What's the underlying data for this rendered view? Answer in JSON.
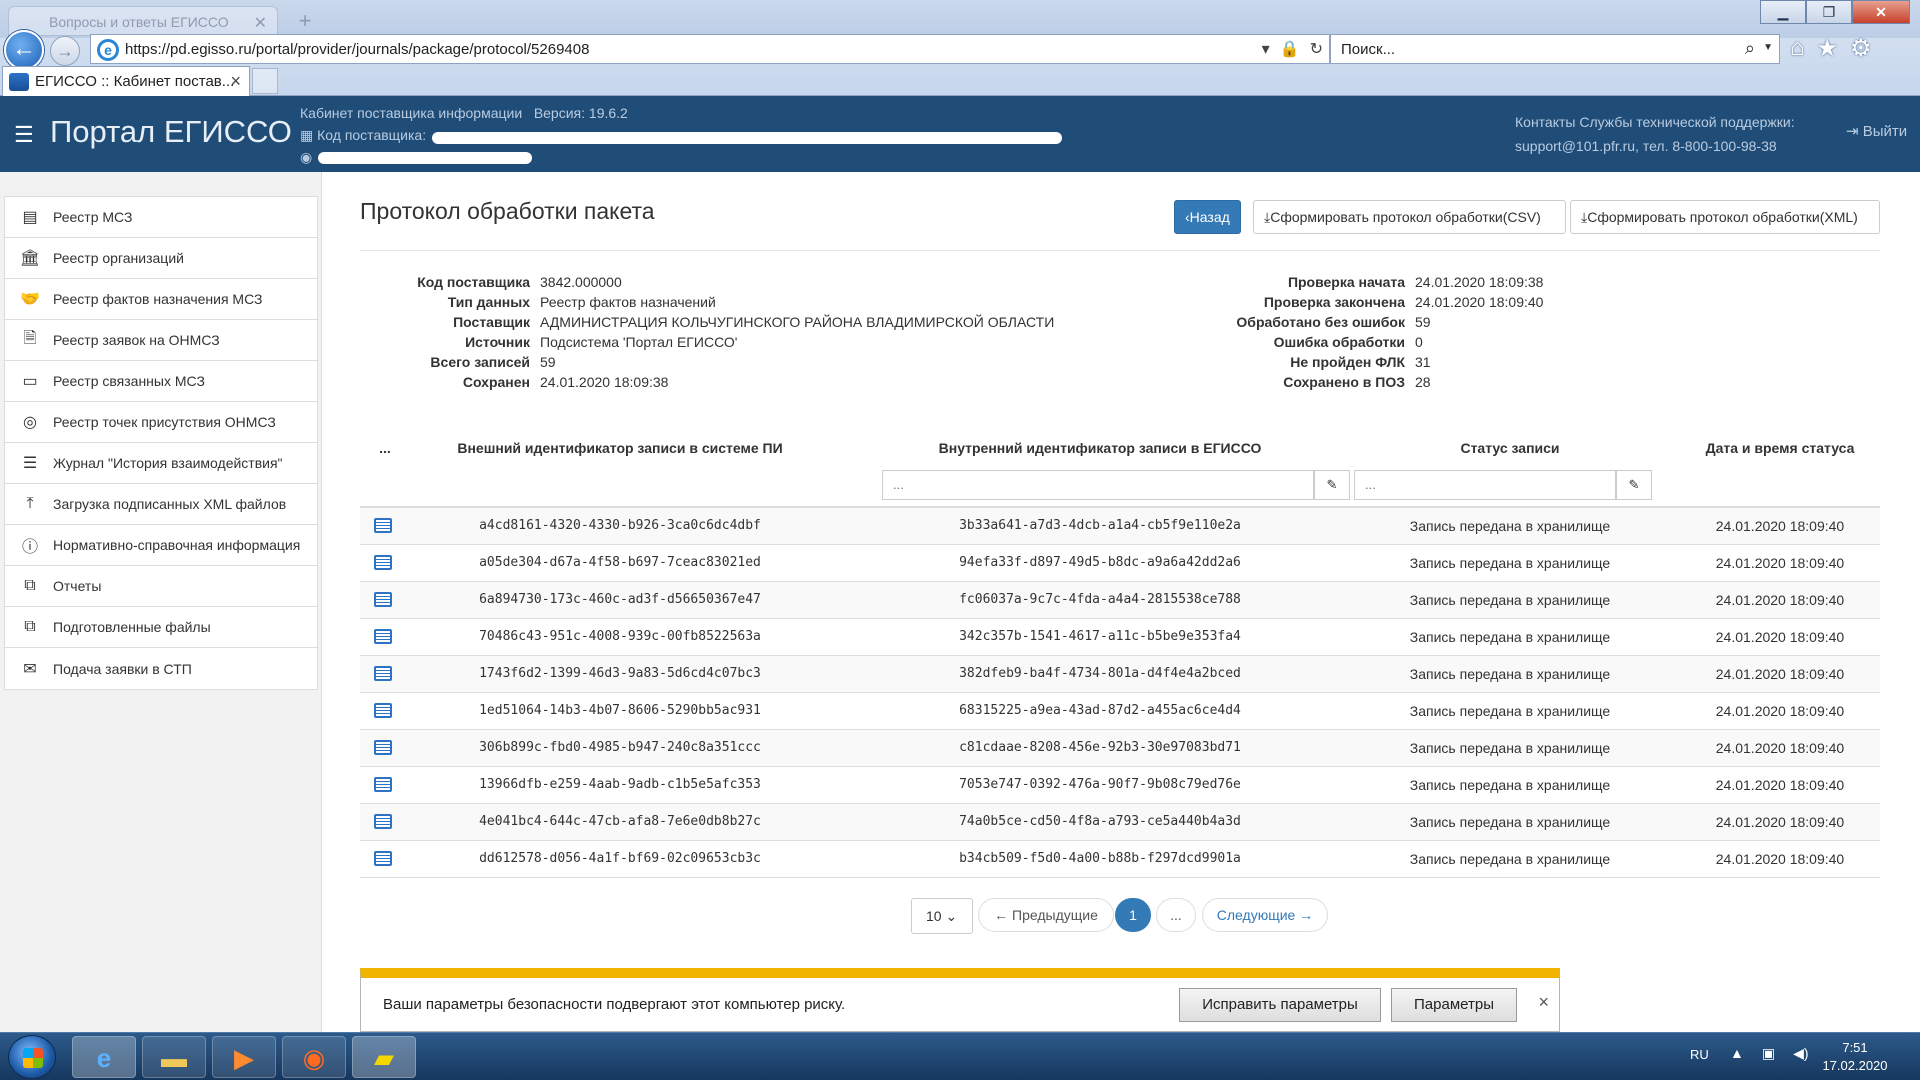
{
  "browser": {
    "ghost_tab_title": "Вопросы и ответы ЕГИССО",
    "url": "https://pd.egisso.ru/portal/provider/journals/package/protocol/5269408",
    "search_placeholder": "Поиск...",
    "tab_title": "ЕГИССО :: Кабинет постав...",
    "icons": [
      "back-arrow-icon",
      "forward-arrow-icon",
      "lock-icon",
      "refresh-icon",
      "search-icon",
      "home-icon",
      "star-icon",
      "gear-icon"
    ]
  },
  "header": {
    "title": "Портал ЕГИССО",
    "cabinet": "Кабинет поставщика информации",
    "version": "Версия: 19.6.2",
    "provider_code_label": "Код поставщика:",
    "support_title": "Контакты Службы технической поддержки:",
    "support_contacts": "support@101.pfr.ru, тел. 8-800-100-98-38",
    "logout": "Выйти"
  },
  "sidebar": {
    "items": [
      {
        "label": "Реестр МСЗ",
        "icon": "book-icon"
      },
      {
        "label": "Реестр организаций",
        "icon": "institution-icon"
      },
      {
        "label": "Реестр фактов назначения МСЗ",
        "icon": "handshake-icon"
      },
      {
        "label": "Реестр заявок на ОНМСЗ",
        "icon": "document-icon"
      },
      {
        "label": "Реестр связанных МСЗ",
        "icon": "card-icon"
      },
      {
        "label": "Реестр точек присутствия ОНМСЗ",
        "icon": "target-icon"
      },
      {
        "label": "Журнал \"История взаимодействия\"",
        "icon": "list-icon"
      },
      {
        "label": "Загрузка подписанных XML файлов",
        "icon": "upload-icon"
      },
      {
        "label": "Нормативно-справочная информация",
        "icon": "info-icon"
      },
      {
        "label": "Отчеты",
        "icon": "copy-icon"
      },
      {
        "label": "Подготовленные файлы",
        "icon": "copy-icon"
      },
      {
        "label": "Подача заявки в СТП",
        "icon": "envelope-icon"
      }
    ]
  },
  "page": {
    "title": "Протокол обработки пакета",
    "back_button": "Назад",
    "csv_button": "Сформировать протокол обработки(CSV)",
    "xml_button": "Сформировать протокол обработки(XML)"
  },
  "info_left": [
    {
      "label": "Код поставщика",
      "value": "3842.000000"
    },
    {
      "label": "Тип данных",
      "value": "Реестр фактов назначений"
    },
    {
      "label": "Поставщик",
      "value": "АДМИНИСТРАЦИЯ КОЛЬЧУГИНСКОГО РАЙОНА ВЛАДИМИРСКОЙ ОБЛАСТИ"
    },
    {
      "label": "Источник",
      "value": "Подсистема 'Портал ЕГИССО'"
    },
    {
      "label": "Всего записей",
      "value": "59"
    },
    {
      "label": "Сохранен",
      "value": "24.01.2020 18:09:38"
    }
  ],
  "info_right": [
    {
      "label": "Проверка начата",
      "value": "24.01.2020 18:09:38"
    },
    {
      "label": "Проверка закончена",
      "value": "24.01.2020 18:09:40"
    },
    {
      "label": "Обработано без ошибок",
      "value": "59"
    },
    {
      "label": "Ошибка обработки",
      "value": "0"
    },
    {
      "label": "Не пройден ФЛК",
      "value": "31"
    },
    {
      "label": "Сохранено в ПОЗ",
      "value": "28"
    }
  ],
  "table": {
    "headers": [
      "...",
      "Внешний идентификатор записи в системе ПИ",
      "Внутренний идентификатор записи в ЕГИССО",
      "Статус записи",
      "Дата и время статуса"
    ],
    "filter_placeholder": "...",
    "rows": [
      {
        "ext": "a4cd8161-4320-4330-b926-3ca0c6dc4dbf",
        "int": "3b33a641-a7d3-4dcb-a1a4-cb5f9e110e2a",
        "status": "Запись передана в хранилище",
        "date": "24.01.2020 18:09:40"
      },
      {
        "ext": "a05de304-d67a-4f58-b697-7ceac83021ed",
        "int": "94efa33f-d897-49d5-b8dc-a9a6a42dd2a6",
        "status": "Запись передана в хранилище",
        "date": "24.01.2020 18:09:40"
      },
      {
        "ext": "6a894730-173c-460c-ad3f-d56650367e47",
        "int": "fc06037a-9c7c-4fda-a4a4-2815538ce788",
        "status": "Запись передана в хранилище",
        "date": "24.01.2020 18:09:40"
      },
      {
        "ext": "70486c43-951c-4008-939c-00fb8522563a",
        "int": "342c357b-1541-4617-a11c-b5be9e353fa4",
        "status": "Запись передана в хранилище",
        "date": "24.01.2020 18:09:40"
      },
      {
        "ext": "1743f6d2-1399-46d3-9a83-5d6cd4c07bc3",
        "int": "382dfeb9-ba4f-4734-801a-d4f4e4a2bced",
        "status": "Запись передана в хранилище",
        "date": "24.01.2020 18:09:40"
      },
      {
        "ext": "1ed51064-14b3-4b07-8606-5290bb5ac931",
        "int": "68315225-a9ea-43ad-87d2-a455ac6ce4d4",
        "status": "Запись передана в хранилище",
        "date": "24.01.2020 18:09:40"
      },
      {
        "ext": "306b899c-fbd0-4985-b947-240c8a351ccc",
        "int": "c81cdaae-8208-456e-92b3-30e97083bd71",
        "status": "Запись передана в хранилище",
        "date": "24.01.2020 18:09:40"
      },
      {
        "ext": "13966dfb-e259-4aab-9adb-c1b5e5afc353",
        "int": "7053e747-0392-476a-90f7-9b08c79ed76e",
        "status": "Запись передана в хранилище",
        "date": "24.01.2020 18:09:40"
      },
      {
        "ext": "4e041bc4-644c-47cb-afa8-7e6e0db8b27c",
        "int": "74a0b5ce-cd50-4f8a-a793-ce5a440b4a3d",
        "status": "Запись передана в хранилище",
        "date": "24.01.2020 18:09:40"
      },
      {
        "ext": "dd612578-d056-4a1f-bf69-02c09653cb3c",
        "int": "b34cb509-f5d0-4a00-b88b-f297dcd9901a",
        "status": "Запись передана в хранилище",
        "date": "24.01.2020 18:09:40"
      }
    ]
  },
  "pager": {
    "page_size": "10",
    "prev": "← Предыдущие",
    "current": "1",
    "ellipsis": "...",
    "next": "Следующие →"
  },
  "notification": {
    "text": "Ваши параметры безопасности подвергают этот компьютер риску.",
    "fix_button": "Исправить параметры",
    "params_button": "Параметры",
    "close": "×",
    "accent": "#f0b400"
  },
  "taskbar": {
    "lang": "RU",
    "time": "7:51",
    "date": "17.02.2020"
  },
  "colors": {
    "header_bg": "#1f4d78",
    "primary": "#337ab7"
  }
}
